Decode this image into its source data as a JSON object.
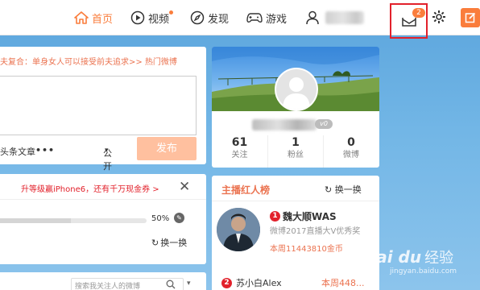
{
  "nav": {
    "home": "首页",
    "video": "视频",
    "discover": "发现",
    "game": "游戏",
    "messages_count": "2"
  },
  "publish": {
    "hot_topic": "夫复合：单身女人可以接受前夫追求>>  热门微博",
    "article": "头条文章",
    "more": "•••",
    "visibility": "公开",
    "send_button": "发布"
  },
  "task": {
    "promo": "升等级赢iPhone6，还有千万现金券 >",
    "close": "✕",
    "progress_percent": 50,
    "progress_label": "50%",
    "swap": "换一换"
  },
  "search": {
    "placeholder": "搜索我关注人的微博"
  },
  "profile": {
    "badge": "v0",
    "stats": [
      {
        "value": "61",
        "label": "关注"
      },
      {
        "value": "1",
        "label": "粉丝"
      },
      {
        "value": "0",
        "label": "微博"
      }
    ]
  },
  "ranking": {
    "title": "主播红人榜",
    "swap": "换一换",
    "items": [
      {
        "rank": "1",
        "name": "魏大顺WAS",
        "desc": "微博2017直播大V优秀奖",
        "score": "本周11443810金币"
      },
      {
        "rank": "2",
        "name": "苏小白Alex",
        "score": "本周448..."
      }
    ]
  },
  "watermark": {
    "logo": "Bai du",
    "text": "经验",
    "sub": "jingyan.baidu.com"
  },
  "colors": {
    "accent": "#fa7d3c",
    "highlight_box": "#e2212b"
  }
}
